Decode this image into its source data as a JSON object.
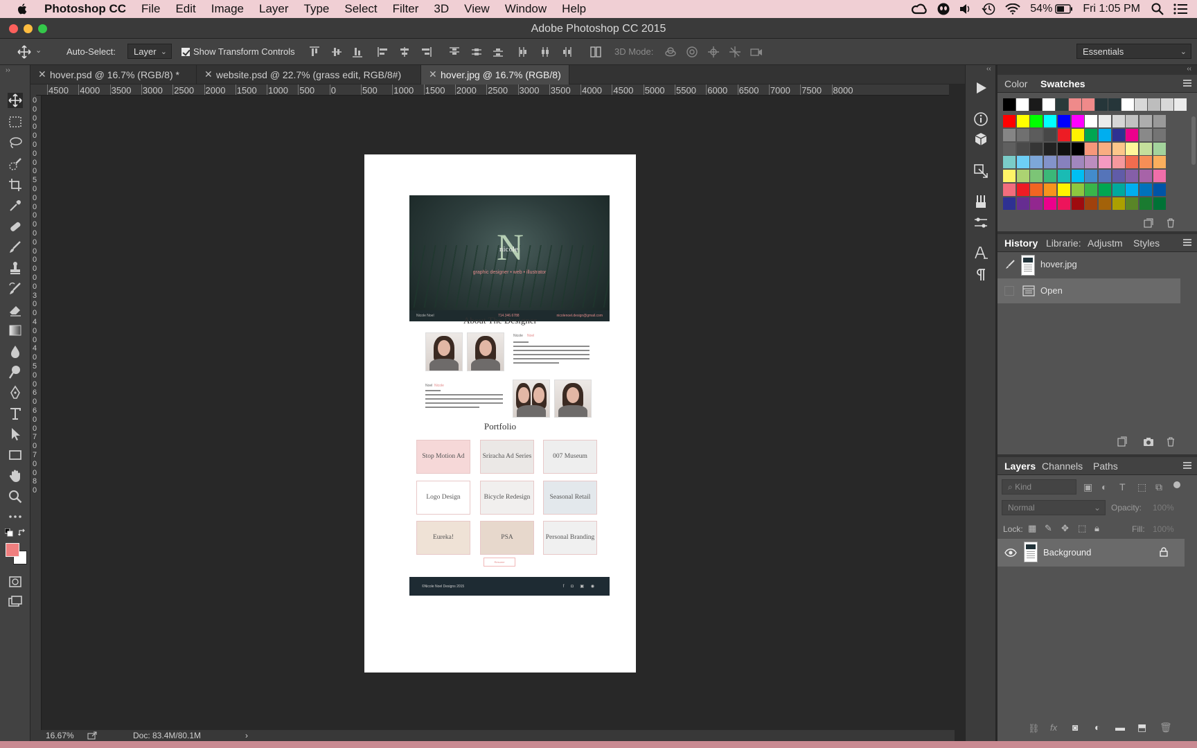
{
  "menubar": {
    "app_name": "Photoshop CC",
    "items": [
      "File",
      "Edit",
      "Image",
      "Layer",
      "Type",
      "Select",
      "Filter",
      "3D",
      "View",
      "Window",
      "Help"
    ],
    "battery": "54%",
    "clock": "Fri 1:05 PM"
  },
  "window": {
    "title": "Adobe Photoshop CC 2015"
  },
  "options": {
    "auto_select_label": "Auto-Select:",
    "auto_select_value": "Layer",
    "show_transform_label": "Show Transform Controls",
    "mode_label": "3D Mode:",
    "workspace": "Essentials"
  },
  "tabs": [
    {
      "label": "hover.psd @ 16.7% (RGB/8) *"
    },
    {
      "label": "website.psd @ 22.7% (grass edit, RGB/8#)"
    },
    {
      "label": "hover.jpg @ 16.7% (RGB/8)"
    }
  ],
  "ruler": {
    "h": [
      "4500",
      "4000",
      "3500",
      "3000",
      "2500",
      "2000",
      "1500",
      "1000",
      "500",
      "0",
      "500",
      "1000",
      "1500",
      "2000",
      "2500",
      "3000",
      "3500",
      "4000",
      "4500",
      "5000",
      "5500",
      "6000",
      "6500",
      "7000",
      "7500",
      "8000"
    ],
    "v": [
      "0",
      "0",
      "0",
      "0",
      "0",
      "0",
      "0",
      "0",
      "0",
      "5",
      "0",
      "0",
      "0",
      "0",
      "0",
      "0",
      "0",
      "0",
      "0",
      "0",
      "0",
      "0",
      "3",
      "0",
      "0",
      "4",
      "0",
      "0",
      "4",
      "0",
      "5",
      "0",
      "0",
      "6",
      "0",
      "6",
      "0",
      "0",
      "7",
      "0",
      "7",
      "0",
      "0",
      "8",
      "0"
    ]
  },
  "document": {
    "hero": {
      "monogram": "N",
      "name": "nicole",
      "tagline": "graphic designer • web • illustrator",
      "strip_left": "Nicole Noel",
      "strip_mid": "714.346.6788",
      "strip_right": "nicolenoel.design@gmail.com"
    },
    "about_title": "About The Designer",
    "bio_name_1": "Nicole",
    "bio_name_2": "Noel",
    "portfolio_title": "Portfolio",
    "portfolio": [
      {
        "label": "Stop Motion Ad",
        "bg": "#f6d8d8"
      },
      {
        "label": "Sriracha Ad Series",
        "bg": "#ebe8e6"
      },
      {
        "label": "007 Museum",
        "bg": "#eeeeee"
      },
      {
        "label": "Logo Design",
        "bg": "#ffffff"
      },
      {
        "label": "Bicycle Redesign",
        "bg": "#f1efee"
      },
      {
        "label": "Seasonal Retail",
        "bg": "#e3e8ec"
      },
      {
        "label": "Eureka!",
        "bg": "#efe2d6"
      },
      {
        "label": "PSA",
        "bg": "#e7d8cc"
      },
      {
        "label": "Personal Branding",
        "bg": "#f0f0f0"
      }
    ],
    "button": "Resume",
    "footer_text": "©Nicole Noel Designs 2015"
  },
  "status": {
    "zoom": "16.67%",
    "doc": "Doc: 83.4M/80.1M"
  },
  "swatches_panel": {
    "tabs": [
      "Color",
      "Swatches"
    ],
    "top_row": [
      "#000000",
      "#ffffff",
      "#1a1a1a",
      "#ffffff",
      "#2a3a3a",
      "#ef8a8a",
      "#ef8a8a",
      "#26363a",
      "#26363a",
      "#ffffff",
      "#d8d8d8",
      "#bdbdbd",
      "#d8d8d8",
      "#ebebeb"
    ],
    "rows": [
      [
        "#ff0000",
        "#ffff00",
        "#00ff00",
        "#00ffff",
        "#0000ff",
        "#ff00ff",
        "#ffffff",
        "#ebebeb",
        "#d6d6d6",
        "#c2c2c2",
        "#adadad",
        "#999999"
      ],
      [
        "#858585",
        "#707070",
        "#5c5c5c",
        "#474747",
        "#ed1c24",
        "#fff200",
        "#00a651",
        "#00aeef",
        "#2e3192",
        "#ec008c",
        "#898989",
        "#747474"
      ],
      [
        "#5f5f5f",
        "#4a4a4a",
        "#363636",
        "#222222",
        "#111111",
        "#000000",
        "#f7977a",
        "#f9ad81",
        "#fdc68a",
        "#fff79a",
        "#c4df9b",
        "#a3d39c"
      ],
      [
        "#7accc8",
        "#6dcff6",
        "#7da7d9",
        "#8393ca",
        "#8781bd",
        "#a187be",
        "#bc8dbf",
        "#f49ac1",
        "#f5989d",
        "#f26c4f",
        "#f68e56",
        "#fbaf5d"
      ],
      [
        "#fff467",
        "#acd372",
        "#7cc576",
        "#3bb878",
        "#1abbb4",
        "#00bff3",
        "#438ccb",
        "#5574b9",
        "#605ca8",
        "#855fa8",
        "#a763a8",
        "#f06ea9"
      ],
      [
        "#f26d7d",
        "#ed1c24",
        "#f26522",
        "#f7941d",
        "#fff200",
        "#8dc73f",
        "#39b54a",
        "#00a651",
        "#00a99d",
        "#00aeef",
        "#0072bc",
        "#0054a6"
      ],
      [
        "#2e3192",
        "#662d91",
        "#92278f",
        "#ec008c",
        "#ed145b",
        "#9e0b0f",
        "#a0410d",
        "#a36209",
        "#aba000",
        "#598527",
        "#1a7b30",
        "#007236"
      ]
    ]
  },
  "history_panel": {
    "tabs": [
      "History",
      "Librarie:",
      "Adjustm",
      "Styles"
    ],
    "snapshot": "hover.jpg",
    "states": [
      "Open"
    ]
  },
  "layers_panel": {
    "tabs": [
      "Layers",
      "Channels",
      "Paths"
    ],
    "kind": "Kind",
    "blend_mode": "Normal",
    "opacity_label": "Opacity:",
    "opacity_value": "100%",
    "lock_label": "Lock:",
    "fill_label": "Fill:",
    "fill_value": "100%",
    "layers": [
      {
        "name": "Background"
      }
    ]
  },
  "colors": {
    "foreground": "#f07f7f",
    "background": "#ffffff",
    "menubar": "#f0cfd4"
  }
}
